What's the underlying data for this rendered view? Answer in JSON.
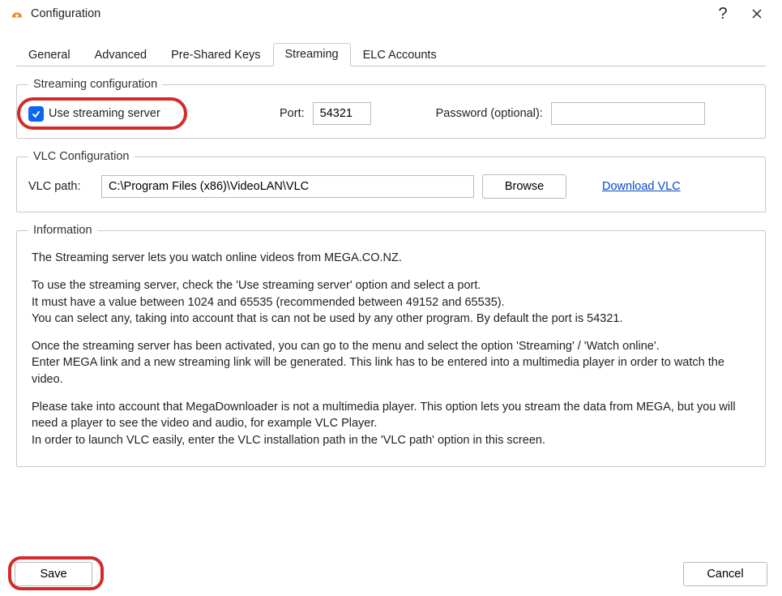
{
  "window": {
    "title": "Configuration"
  },
  "tabs": {
    "general": "General",
    "advanced": "Advanced",
    "psk": "Pre-Shared Keys",
    "streaming": "Streaming",
    "elc": "ELC Accounts"
  },
  "streaming": {
    "legend": "Streaming configuration",
    "use_streaming_label": "Use streaming server",
    "port_label": "Port:",
    "port_value": "54321",
    "password_label": "Password (optional):",
    "password_value": ""
  },
  "vlc": {
    "legend": "VLC Configuration",
    "path_label": "VLC path:",
    "path_value": "C:\\Program Files (x86)\\VideoLAN\\VLC",
    "browse_label": "Browse",
    "download_label": "Download VLC"
  },
  "info": {
    "legend": "Information",
    "p1": "The Streaming server lets you watch online videos from MEGA.CO.NZ.",
    "p2": "To use the streaming server, check the 'Use streaming server' option and select a port.\nIt must have a value between 1024 and 65535 (recommended between 49152 and 65535).\nYou can select any, taking into account that is can not be used by any other program. By default the port is 54321.",
    "p3": "Once the streaming server has been activated, you can go to the menu and select the option 'Streaming' / 'Watch online'.\nEnter MEGA link and a new streaming link will be generated. This link has to be entered into a multimedia player in order to watch the video.",
    "p4": "Please take into account that MegaDownloader is not a multimedia player. This option lets you stream the data from MEGA, but you will need a player to see the video and audio, for example VLC Player.\nIn order to launch VLC easily, enter the VLC installation path in the 'VLC path' option in this screen."
  },
  "footer": {
    "save": "Save",
    "cancel": "Cancel"
  }
}
